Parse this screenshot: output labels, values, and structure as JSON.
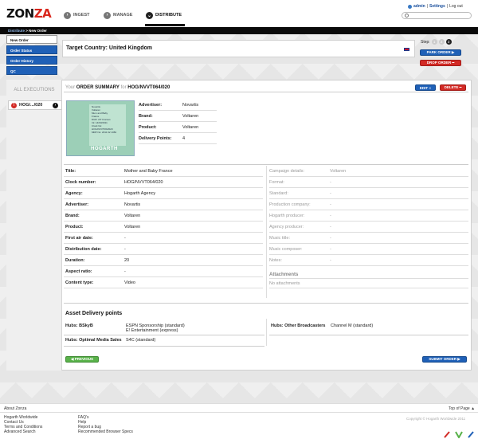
{
  "brand": {
    "name_part1": "ZON",
    "name_part2": "ZA"
  },
  "nav": {
    "ingest": "INGEST",
    "manage": "MANAGE",
    "distribute": "DISTRIBUTE"
  },
  "user": {
    "name": "admin",
    "settings": "Settings",
    "logout": "Log out"
  },
  "breadcrumb": {
    "link": "Distribute",
    "sep": " > ",
    "current": "New Order"
  },
  "sidebar": {
    "items": [
      {
        "label": "New Order"
      },
      {
        "label": "Order Status"
      },
      {
        "label": "Order History"
      },
      {
        "label": "QC"
      }
    ]
  },
  "target": {
    "title": "Target Country: United Kingdom"
  },
  "step": {
    "label": "Step:",
    "s1": "1",
    "s2": "2",
    "s3": "3"
  },
  "actions": {
    "park": "PARK ORDER ▶",
    "drop": "DROP ORDER ━"
  },
  "executions": {
    "header": "ALL EXECUTIONS",
    "item": "HOG/.../020",
    "warn": "!",
    "go": "›"
  },
  "summary": {
    "prefix": "Your ",
    "title": "ORDER SUMMARY",
    "for": " for ",
    "clock": "HOG/NVVT064/020",
    "edit": "EDIT ≡",
    "delete": "DELETE ━"
  },
  "thumb": {
    "lines": [
      "Novartis",
      "Voltaren",
      "Mum and Baby",
      "France",
      "DUR: 20\" Frames",
      "Int: 14/03/2011",
      "Clock No:",
      "HOG/NVVT064/020",
      "MRP No: 2011 02 1084"
    ],
    "brand": "HOGARTH"
  },
  "overview": [
    {
      "k": "Advertiser:",
      "v": "Novartis"
    },
    {
      "k": "Brand:",
      "v": "Voltaren"
    },
    {
      "k": "Product:",
      "v": "Voltaren"
    },
    {
      "k": "Delivery Points:",
      "v": "4"
    }
  ],
  "details_left": [
    {
      "k": "Title:",
      "v": "Mother and Baby France"
    },
    {
      "k": "Clock number:",
      "v": "HOG/NVVT064/020"
    },
    {
      "k": "Agency:",
      "v": "Hogarth Agency"
    },
    {
      "k": "Advertiser:",
      "v": "Novartis"
    },
    {
      "k": "Brand:",
      "v": "Voltaren"
    },
    {
      "k": "Product:",
      "v": "Voltaren"
    },
    {
      "k": "First air date:",
      "v": "-"
    },
    {
      "k": "Distribution date:",
      "v": "-"
    },
    {
      "k": "Duration:",
      "v": "20"
    },
    {
      "k": "Aspect ratio:",
      "v": "-"
    },
    {
      "k": "Content type:",
      "v": "Video"
    }
  ],
  "details_right": [
    {
      "k": "Campaign details:",
      "v": "Voltaren"
    },
    {
      "k": "Format:",
      "v": "-"
    },
    {
      "k": "Standard:",
      "v": "-"
    },
    {
      "k": "Production company:",
      "v": "-"
    },
    {
      "k": "Hogarth producer:",
      "v": "-"
    },
    {
      "k": "Agency producer:",
      "v": "-"
    },
    {
      "k": "Music title:",
      "v": "-"
    },
    {
      "k": "Music composer:",
      "v": "-"
    },
    {
      "k": "Notes:",
      "v": "-"
    }
  ],
  "attachments": {
    "title": "Attachments",
    "empty": "No attachments"
  },
  "assets": {
    "title": "Asset Delivery points",
    "hub1": {
      "k": "Hubs: BSkyB",
      "v1": "ESPN Sponsorship (standard)",
      "v2": "E! Entertainment (express)"
    },
    "hub2": {
      "k": "Hubs: Optimal Media Sales",
      "v": "S4C (standard)"
    },
    "hub3": {
      "k": "Hubs: Other Broadcasters",
      "v": "Channel M (standard)"
    }
  },
  "nav_buttons": {
    "previous": "◀ PREVIOUS",
    "submit": "SUBMIT ORDER ▶"
  },
  "footer": {
    "about": "About Zonza",
    "top": "Top of Page ▲",
    "col1": [
      "Hogarth Worldwide",
      "Contact Us",
      "Terms and Conditions",
      "Advanced Search"
    ],
    "col2": [
      "FAQ's",
      "Help",
      "Report a bug",
      "Recommended Browser Specs"
    ],
    "copyright": "Copyright © Hogarth Worldwide 2011"
  }
}
